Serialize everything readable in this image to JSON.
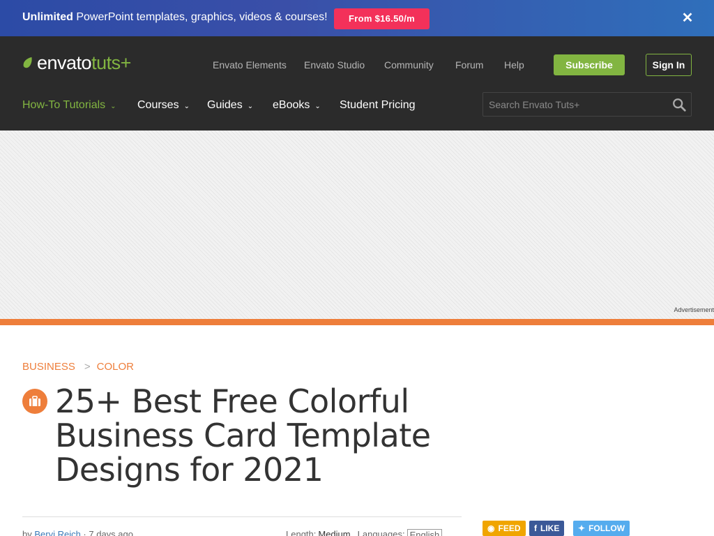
{
  "promo": {
    "bold": "Unlimited",
    "text": " PowerPoint templates, graphics, videos & courses!",
    "button": "From $16.50/m",
    "close": "✕"
  },
  "header": {
    "logo_main": "envato",
    "logo_sub": "tuts+",
    "top_links": [
      "Envato Elements",
      "Envato Studio",
      "Community",
      "Forum",
      "Help"
    ],
    "subscribe": "Subscribe",
    "sign_in": "Sign In",
    "nav": [
      "How-To Tutorials",
      "Courses",
      "Guides",
      "eBooks",
      "Student Pricing"
    ],
    "search_placeholder": "Search Envato Tuts+",
    "accent": "#82b541"
  },
  "ad": {
    "label": "Advertisement"
  },
  "article": {
    "breadcrumb": [
      "BUSINESS",
      ">",
      "COLOR"
    ],
    "title": "25+ Best Free Colorful Business Card Template Designs for 2021",
    "byline_prefix": "by ",
    "author": "Bervi Reich",
    "date": "7 days ago",
    "length_label": "Length:",
    "length_value": "Medium",
    "language_label": "Languages:",
    "language_value": "English",
    "accent": "#ee7e3b"
  },
  "social": {
    "feed": "FEED",
    "like": "LIKE",
    "follow": "FOLLOW"
  }
}
